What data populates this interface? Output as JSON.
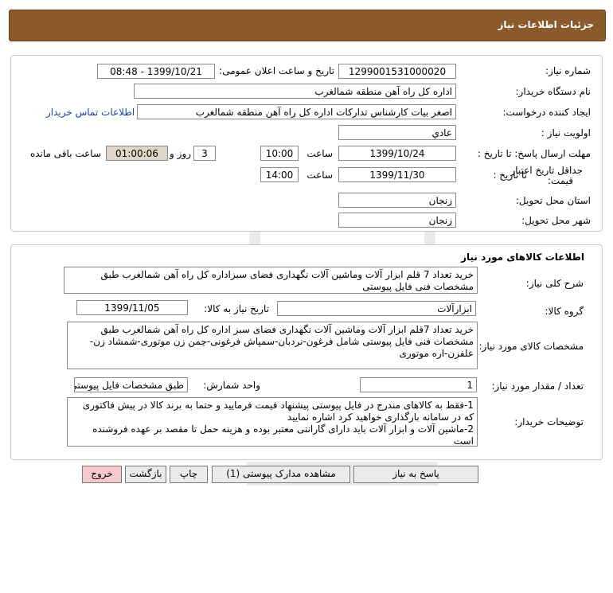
{
  "header": {
    "title": "جزئیات اطلاعات نیاز"
  },
  "info": {
    "need_number_label": "شماره نیاز:",
    "need_number": "1299001531000020",
    "announce_label": "تاریخ و ساعت اعلان عمومی:",
    "announce_value": "1399/10/21 - 08:48",
    "buyer_label": "نام دستگاه خریدار:",
    "buyer_value": "اداره کل راه آهن منطقه شمالغرب",
    "creator_label": "ایجاد کننده درخواست:",
    "creator_value": "اصغر بیات کارشناس تدارکات اداره کل راه آهن منطقه شمالغرب",
    "contact_link": "اطلاعات تماس خریدار",
    "priority_label": "اولویت نیاز :",
    "priority_value": "عادي",
    "deadline_label": "مهلت ارسال پاسخ: تا تاریخ :",
    "deadline_date": "1399/10/24",
    "time_label": "ساعت",
    "deadline_time": "10:00",
    "days_value": "3",
    "days_label": "روز و",
    "remaining_value": "01:00:06",
    "remaining_label": "ساعت باقی مانده",
    "validity_label_1": "جداقل تاریخ اعتبار",
    "validity_label_2": "قیمت:",
    "validity_to_label": "تا تاریخ :",
    "validity_date": "1399/11/30",
    "validity_time_label": "ساعت",
    "validity_time": "14:00",
    "province_label": "استان محل تحویل:",
    "province_value": "زنجان",
    "city_label": "شهر محل تحویل:",
    "city_value": "زنجان"
  },
  "goods": {
    "section_title": "اطلاعات کالاهای مورد نیاز",
    "desc_label": "شرح کلی نیاز:",
    "desc_value": "خرید تعداد 7 قلم ابزار آلات  وماشین آلات نگهداری فضای سبزاداره کل راه آهن شمالغرب طبق مشخصات فنی فایل پیوستی",
    "group_label": "گروه کالا:",
    "group_value": "ابزارآلات",
    "need_date_label": "تاریخ نیاز به کالا:",
    "need_date_value": "1399/11/05",
    "spec_label": "مشخصات کالای مورد نیاز:",
    "spec_value": "خرید تعداد 7قلم ابزار آلات  وماشین آلات نگهداری فضای سبز اداره کل راه آهن شمالغرب طبق مشخصات فنی فایل پیوستی شامل فرغون-نردبان-سمپاش فرغونی-چمن زن موتوری-شمشاد زن-علفزن-اره موتوری",
    "qty_label": "تعداد / مقدار مورد نیاز:",
    "qty_value": "1",
    "unit_label": "واحد شمارش:",
    "unit_value": "طبق مشخصات فایل پیوستی",
    "notes_label": "توضیحات خریدار:",
    "notes_value": "1-فقط به کالاهای مندرج در فایل پیوستی پیشنهاد قیمت فرمایید و حتما به برند کالا در پیش فاکتوری که در سامانه بارگذاری خواهید کرد اشاره نمایید\n2-ماشین آلات و ابزار آلات باید دارای گارانتی معتبر بوده و هزینه حمل تا مقصد بر عهده فروشنده است"
  },
  "buttons": {
    "reply": "پاسخ به نیاز",
    "attachments": "مشاهده مدارک پیوستی (1)",
    "print": "چاپ",
    "back": "بازگشت",
    "exit": "خروج"
  }
}
